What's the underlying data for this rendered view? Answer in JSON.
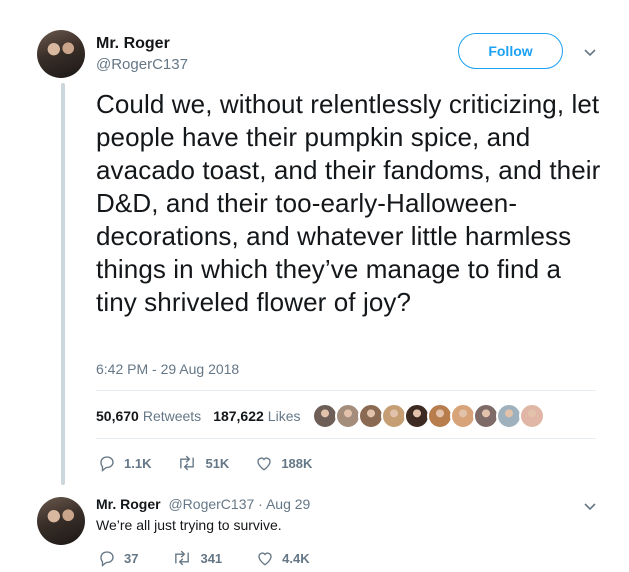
{
  "main_tweet": {
    "author_name": "Mr. Roger",
    "author_handle": "@RogerC137",
    "follow_label": "Follow",
    "text": "Could we, without relentlessly criticizing, let people have their pumpkin spice, and avacado toast, and their fandoms, and their D&D, and their too-early-Halloween-decorations, and whatever little harmless things in which they’ve manage to find a tiny shriveled flower of joy?",
    "timestamp": "6:42 PM - 29 Aug 2018",
    "retweets_count": "50,670",
    "retweets_label": "Retweets",
    "likes_count": "187,622",
    "likes_label": "Likes",
    "liker_avatar_colors": [
      "#6d5f57",
      "#a58d7c",
      "#8a6a52",
      "#c59e74",
      "#3d2a22",
      "#b77d4c",
      "#d9a37a",
      "#7e6a67",
      "#9fb1bd",
      "#e0b7a6"
    ],
    "actions": {
      "replies": "1.1K",
      "retweets": "51K",
      "likes": "188K"
    }
  },
  "reply_tweet": {
    "author_name": "Mr. Roger",
    "author_handle": "@RogerC137",
    "separator": "·",
    "date": "Aug 29",
    "text": "We’re all just trying to survive.",
    "actions": {
      "replies": "37",
      "retweets": "341",
      "likes": "4.4K"
    }
  },
  "icons": {
    "reply": "speech-bubble-icon",
    "retweet": "retweet-icon",
    "like": "heart-icon",
    "more": "chevron-down-icon"
  },
  "colors": {
    "accent": "#1da1f2",
    "muted": "#657786",
    "text": "#14171a",
    "divider": "#e6ecf0"
  }
}
